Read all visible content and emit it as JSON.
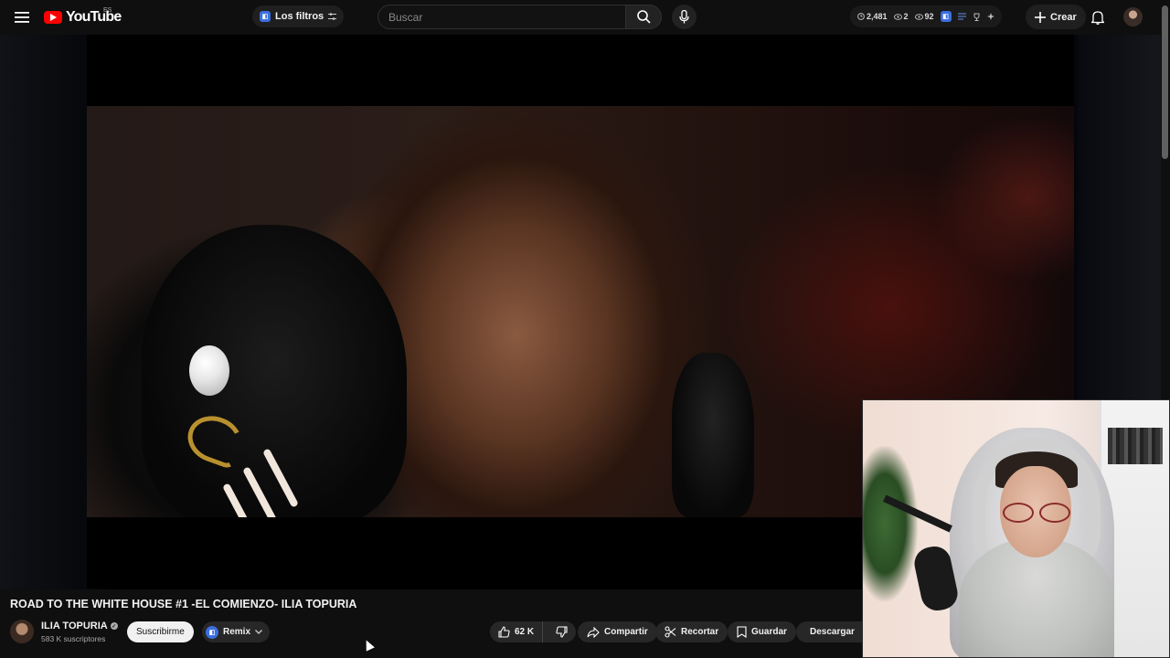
{
  "header": {
    "logo_text": "YouTube",
    "region": "ES",
    "filters_label": "Los filtros",
    "search_placeholder": "Buscar",
    "stats": {
      "watch": "2,481",
      "views_a": "2",
      "views_b": "92"
    },
    "create_label": "Crear",
    "icons": [
      "menu-icon",
      "search-icon",
      "mic-icon",
      "plus-icon",
      "bell-icon"
    ]
  },
  "video": {
    "title": "ROAD TO THE WHITE HOUSE #1 -EL COMIENZO- ILIA TOPURIA"
  },
  "channel": {
    "name": "ILIA TOPURIA",
    "subscribers": "583 K suscriptores",
    "subscribe_label": "Suscribirme",
    "remix_label": "Remix"
  },
  "actions": {
    "likes": "62 K",
    "share_label": "Compartir",
    "clip_label": "Recortar",
    "save_label": "Guardar",
    "download_label": "Descargar"
  },
  "colors": {
    "brand": "#ff0000",
    "background": "#0f0f0f",
    "chip": "#272727",
    "extension": "#3b6fe0"
  }
}
